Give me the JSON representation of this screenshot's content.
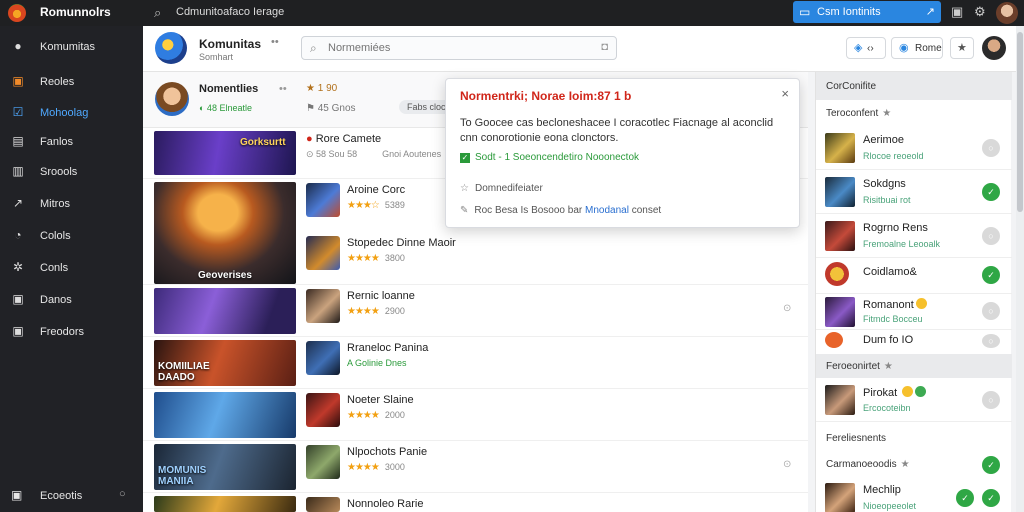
{
  "topbar": {
    "app_title": "Romunnolrs",
    "search_text": "Cdmunitoafaco Ierage",
    "action_label": "Csm Iontinits",
    "logo_icon": "app-logo-icon"
  },
  "sidebar": {
    "items": [
      {
        "icon": "●",
        "label": "Komumitas"
      },
      {
        "icon": "▣",
        "label": "Reoles"
      },
      {
        "icon": "☑",
        "label": "Mohoolag"
      },
      {
        "icon": "▤",
        "label": "Fanlos"
      },
      {
        "icon": "▥",
        "label": "Sroools"
      },
      {
        "icon": "↗",
        "label": "Mitros"
      },
      {
        "icon": "◔",
        "label": "Colols"
      },
      {
        "icon": "✲",
        "label": "Conls"
      },
      {
        "icon": "▣",
        "label": "Danos"
      },
      {
        "icon": "▣",
        "label": "Freodors"
      }
    ],
    "footer": {
      "icon": "▣",
      "label": "Ecoeotis",
      "dot": "○"
    }
  },
  "header": {
    "title": "Komunitas",
    "subtitle": "Somhart",
    "more": "••",
    "search_placeholder": "Normemiées",
    "btn1_label": "‹›",
    "btn2_label": "Rome"
  },
  "profile": {
    "name": "Nomentlies",
    "sub": "◐ 48  Elneatle",
    "dots": "••",
    "stat1": "★ 1 90",
    "stat2": "⚑ 45  Gnos",
    "chip": "Fabs cloc"
  },
  "games": [
    {
      "title": "Rore Camete",
      "meta": "⊙ 58  Sou 58",
      "rating": "",
      "extra": "Gnoi Aoutenes",
      "banner_text": "Gorksurtt"
    },
    {
      "title": "Aroine Corc",
      "meta": "5389",
      "rating": "★★★☆",
      "extra": "",
      "banner_text": "Geoverises"
    },
    {
      "title": "Stopedec Dinne Maoir",
      "meta": "3800",
      "rating": "★★★★",
      "extra": "",
      "banner_text": ""
    },
    {
      "title": "Rernic loanne",
      "meta": "2900",
      "rating": "★★★★",
      "extra": "",
      "banner_text": ""
    },
    {
      "title": "Rraneloc Panina",
      "meta": "A Golinie Dnes",
      "rating": "",
      "extra": "",
      "banner_text": "KOMIILIAE DAADO"
    },
    {
      "title": "Noeter Slaine",
      "meta": "2000",
      "rating": "★★★★",
      "extra": "",
      "banner_text": ""
    },
    {
      "title": "Nlpochots Panie",
      "meta": "3000",
      "rating": "★★★★",
      "extra": "",
      "banner_text": "MOMUNIS MANIIA"
    },
    {
      "title": "Nonnoleo Rarie",
      "meta": "",
      "rating": "",
      "extra": "",
      "banner_text": ""
    }
  ],
  "popup": {
    "title": "Normentrki; Norae Ioim:87 1 b",
    "close": "×",
    "body": "To Goocee cas becloneshacee I coracotlec Fiacnage al aconclid cnn conorotionie eona clonctors.",
    "status": "Sodt - 1  Soeoncendetiro Nooonectok",
    "line1": "Domnedifeiater",
    "line2_prefix": "Roc  Besa  Is Bosooo bar",
    "line2_link": "Mnodanal",
    "line2_suffix": "conset"
  },
  "right": {
    "head": "CorConifite",
    "sub1": "Teroconfent",
    "items": [
      {
        "name": "Aerimoe",
        "desc": "Rlocoe reoeold",
        "status": "gray"
      },
      {
        "name": "Sokdgns",
        "desc": "Risitbuai rot",
        "status": "green"
      },
      {
        "name": "Rogrno Rens",
        "desc": "Fremoalne Leooalk",
        "status": "gray"
      },
      {
        "name": "Coidlamo&",
        "desc": "",
        "status": "green"
      },
      {
        "name": "Romanont",
        "desc": "Fitmdc Bocceu",
        "status": "gray"
      },
      {
        "name": "Dum fo IO",
        "desc": "",
        "status": "gray"
      }
    ],
    "sep1": "Feroeonirtet",
    "single": {
      "name": "Pirokat",
      "desc": "Ercocoteibn",
      "status": "gray"
    },
    "sep2_title": "Fereliesnents",
    "sep3_title": "Carmanoeoodis",
    "last": {
      "name": "Mechlip",
      "desc": "Nioeopeeolet",
      "status": "green"
    }
  }
}
